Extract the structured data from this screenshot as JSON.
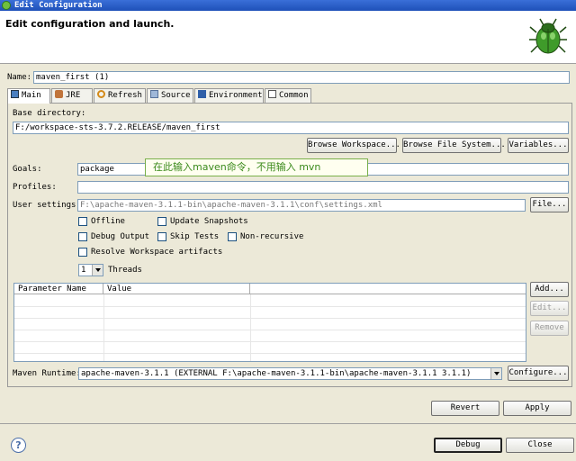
{
  "window": {
    "title": "Edit Configuration"
  },
  "header": {
    "heading": "Edit configuration and launch."
  },
  "name": {
    "label": "Name:",
    "value": "maven_first (1)"
  },
  "tabs": [
    {
      "label": "Main",
      "icon": "main-tab-icon",
      "active": true
    },
    {
      "label": "JRE",
      "icon": "jre-icon"
    },
    {
      "label": "Refresh",
      "icon": "refresh-icon"
    },
    {
      "label": "Source",
      "icon": "source-icon"
    },
    {
      "label": "Environment",
      "icon": "environment-icon"
    },
    {
      "label": "Common",
      "icon": "common-icon"
    }
  ],
  "main": {
    "base_dir_label": "Base directory:",
    "base_dir_value": "F:/workspace-sts-3.7.2.RELEASE/maven_first",
    "browse_workspace": "Browse Workspace...",
    "browse_fs": "Browse File System...",
    "variables": "Variables...",
    "goals_label": "Goals:",
    "goals_value": "package",
    "tooltip": "在此输入maven命令，不用输入 mvn",
    "profiles_label": "Profiles:",
    "profiles_value": "",
    "user_settings_label": "User settings:",
    "user_settings_value": "F:\\apache-maven-3.1.1-bin\\apache-maven-3.1.1\\conf\\settings.xml",
    "file_button": "File...",
    "offline": "Offline",
    "update_snapshots": "Update Snapshots",
    "debug_output": "Debug Output",
    "skip_tests": "Skip Tests",
    "non_recursive": "Non-recursive",
    "resolve_workspace": "Resolve Workspace artifacts",
    "threads_value": "1",
    "threads_label": "Threads",
    "param_headers": [
      "Parameter Name",
      "Value"
    ],
    "add_button": "Add...",
    "edit_button": "Edit...",
    "remove_button": "Remove",
    "runtime_label": "Maven Runtime:",
    "runtime_value": "apache-maven-3.1.1  (EXTERNAL F:\\apache-maven-3.1.1-bin\\apache-maven-3.1.1 3.1.1)",
    "configure_button": "Configure..."
  },
  "footer": {
    "revert": "Revert",
    "apply": "Apply",
    "debug": "Debug",
    "close": "Close"
  },
  "colors": {
    "title_bar": "#1e50b8",
    "tooltip_text": "#3b8a1c",
    "dialog_bg": "#ece9d8"
  }
}
